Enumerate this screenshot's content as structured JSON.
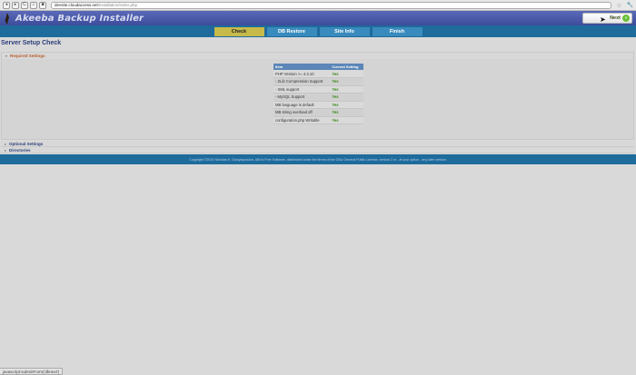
{
  "browser": {
    "url_host": "devsite.cloudaccess.net",
    "url_path": "/installation/index.php",
    "nav_back": "◂",
    "nav_forward": "▸",
    "nav_reload": "C",
    "nav_home": "⌂",
    "nav_stop": "■",
    "star": "☆",
    "wrench": "🔧"
  },
  "header": {
    "title": "Akeeba Backup Installer",
    "next_label": "Next",
    "next_icon": "»"
  },
  "tabs": [
    {
      "label": "Check",
      "active": true
    },
    {
      "label": "DB Restore",
      "active": false
    },
    {
      "label": "Site Info",
      "active": false
    },
    {
      "label": "Finish",
      "active": false
    }
  ],
  "page": {
    "title": "Server Setup Check",
    "required_label": "Required Settings",
    "optional_label": "Optional Settings",
    "directories_label": "Directories"
  },
  "settings_table": {
    "columns": [
      "Item",
      "Current Setting"
    ],
    "rows": [
      {
        "item": "PHP Version >= 4.3.10",
        "value": "Yes"
      },
      {
        "item": "- ZLib Compression Support",
        "value": "Yes"
      },
      {
        "item": "- XML support",
        "value": "Yes"
      },
      {
        "item": "- MySQL Support",
        "value": "Yes"
      },
      {
        "item": "MB language is default",
        "value": "Yes"
      },
      {
        "item": "MB string overload off",
        "value": "Yes"
      },
      {
        "item": "configuration.php Writable",
        "value": "Yes"
      }
    ]
  },
  "footer": {
    "text": "Copyright ©2010 Nicholas K. Dionysopoulos. ABI is Free Software, distributed under the terms of the GNU General Public License, version 2 or - at your option - any later version."
  },
  "status_bar": {
    "text": "javascript:submitForm('dbnext')"
  },
  "colors": {
    "header": "#4a5aac",
    "tabs_bar": "#1e6b9c",
    "tab_active": "#c7ba4a",
    "required_label": "#b85c28",
    "yes_value": "#3a8a1a"
  }
}
